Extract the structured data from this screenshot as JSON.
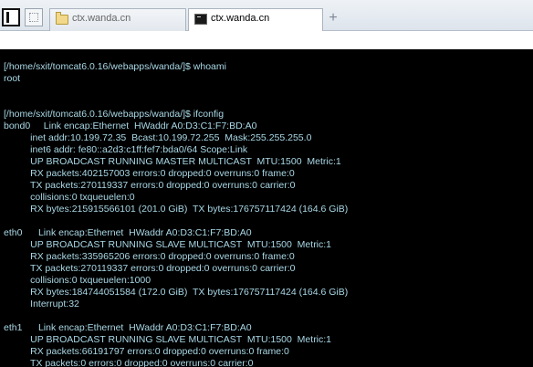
{
  "tabs": [
    {
      "label": "ctx.wanda.cn",
      "icon": "folder-icon",
      "active": false
    },
    {
      "label": "ctx.wanda.cn",
      "icon": "terminal-icon",
      "active": true
    }
  ],
  "new_tab_label": "+",
  "terminal": {
    "text_color": "#a9d8e6",
    "background": "#000000",
    "lines": [
      "[/home/sxit/tomcat6.0.16/webapps/wanda/]$ whoami",
      "root",
      "",
      "",
      "[/home/sxit/tomcat6.0.16/webapps/wanda/]$ ifconfig",
      "bond0     Link encap:Ethernet  HWaddr A0:D3:C1:F7:BD:A0",
      "          inet addr:10.199.72.35  Bcast:10.199.72.255  Mask:255.255.255.0",
      "          inet6 addr: fe80::a2d3:c1ff:fef7:bda0/64 Scope:Link",
      "          UP BROADCAST RUNNING MASTER MULTICAST  MTU:1500  Metric:1",
      "          RX packets:402157003 errors:0 dropped:0 overruns:0 frame:0",
      "          TX packets:270119337 errors:0 dropped:0 overruns:0 carrier:0",
      "          collisions:0 txqueuelen:0",
      "          RX bytes:215915566101 (201.0 GiB)  TX bytes:176757117424 (164.6 GiB)",
      "",
      "eth0      Link encap:Ethernet  HWaddr A0:D3:C1:F7:BD:A0",
      "          UP BROADCAST RUNNING SLAVE MULTICAST  MTU:1500  Metric:1",
      "          RX packets:335965206 errors:0 dropped:0 overruns:0 frame:0",
      "          TX packets:270119337 errors:0 dropped:0 overruns:0 carrier:0",
      "          collisions:0 txqueuelen:1000",
      "          RX bytes:184744051584 (172.0 GiB)  TX bytes:176757117424 (164.6 GiB)",
      "          Interrupt:32",
      "",
      "eth1      Link encap:Ethernet  HWaddr A0:D3:C1:F7:BD:A0",
      "          UP BROADCAST RUNNING SLAVE MULTICAST  MTU:1500  Metric:1",
      "          RX packets:66191797 errors:0 dropped:0 overruns:0 frame:0",
      "          TX packets:0 errors:0 dropped:0 overruns:0 carrier:0"
    ]
  }
}
